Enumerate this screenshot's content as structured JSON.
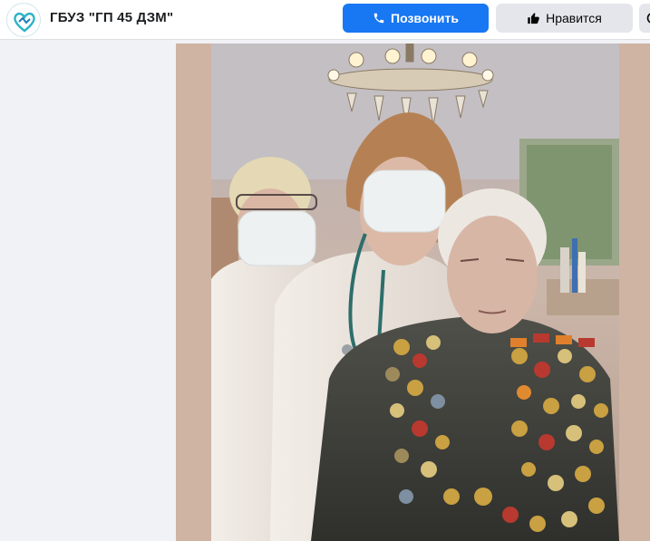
{
  "header": {
    "page_name": "ГБУЗ \"ГП 45 ДЗМ\"",
    "logo_icon": "clinic-heart-logo",
    "call_button": {
      "label": "Позвонить",
      "icon": "phone-icon"
    },
    "like_button": {
      "label": "Нравится",
      "icon": "thumbs-up-icon"
    },
    "more_button": {
      "icon": "more-icon"
    }
  },
  "post": {
    "photo_icon": "photo-medics-with-veteran"
  },
  "colors": {
    "brand_blue": "#1877f2",
    "button_gray": "#e4e6eb",
    "page_bg": "#f0f2f5",
    "photo_bg": "#cfb4a3"
  }
}
